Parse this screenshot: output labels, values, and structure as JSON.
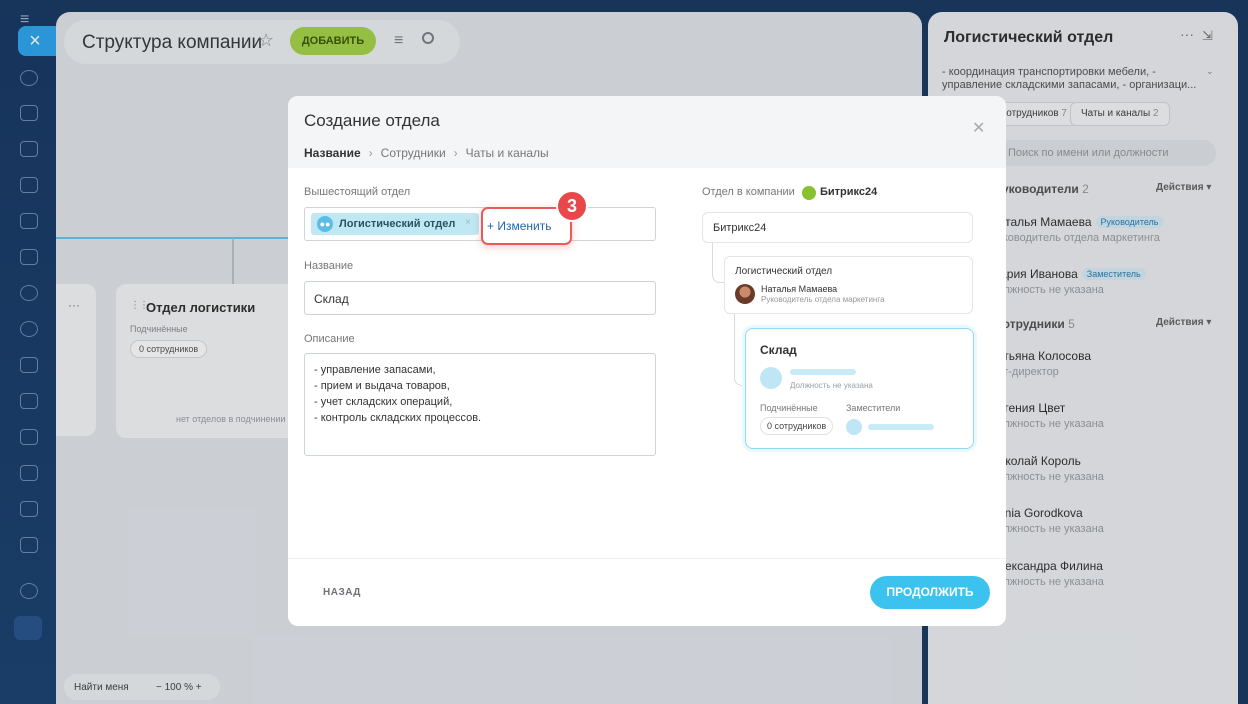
{
  "main": {
    "title": "Структура компании",
    "add_label": "ДОБАВИТЬ",
    "card_dept_name": "Отдел логистики",
    "card_sub_label": "Подчинённые",
    "card_sub_count": "0 сотрудников",
    "card_no_depts": "нет отделов в подчинении",
    "find_me": "Найти меня",
    "zoom": "− 100 % +"
  },
  "right": {
    "title": "Логистический отдел",
    "description": "- координация транспортировки мебели, - управление складскими запасами, - организаци...",
    "tab1_label": "Сотрудников",
    "tab1_count": "7",
    "tab2_label": "Чаты и каналы",
    "tab2_count": "2",
    "search_placeholder": "Поиск по имени или должности",
    "sections": [
      {
        "label": "Руководители",
        "count": "2",
        "action": "Действия"
      },
      {
        "label": "Сотрудники",
        "count": "5",
        "action": "Действия"
      }
    ],
    "employees": [
      {
        "name": "Наталья Мамаева",
        "badge": "Руководитель",
        "role": "Руководитель отдела маркетинга"
      },
      {
        "name": "Мария Иванова",
        "badge": "Заместитель",
        "role": "Должность не указана"
      },
      {
        "name": "Татьяна Колосова",
        "badge": "",
        "role": "Арт-директор"
      },
      {
        "name": "Евгения Цвет",
        "badge": "",
        "role": "Должность не указана"
      },
      {
        "name": "Николай Король",
        "badge": "",
        "role": "Должность не указана"
      },
      {
        "name": "Xenia Gorodkova",
        "badge": "",
        "role": "Должность не указана"
      },
      {
        "name": "Александра Филина",
        "badge": "",
        "role": "Должность не указана"
      }
    ]
  },
  "modal": {
    "title": "Создание отдела",
    "steps": [
      "Название",
      "Сотрудники",
      "Чаты и каналы"
    ],
    "parent_label": "Вышестоящий отдел",
    "parent_value": "Логистический отдел",
    "change_label": "+ Изменить",
    "step_number": "3",
    "name_label": "Название",
    "name_value": "Склад",
    "desc_label": "Описание",
    "desc_lines": [
      "- управление запасами,",
      "- прием и выдача товаров,",
      "- учет складских операций,",
      "- контроль складских процессов."
    ],
    "back_label": "НАЗАД",
    "continue_label": "ПРОДОЛЖИТЬ",
    "preview": {
      "label": "Отдел в компании",
      "company": "Битрикс24",
      "root": "Битрикс24",
      "parent_dept": "Логистический отдел",
      "head_name": "Наталья Мамаева",
      "head_role": "Руководитель отдела маркетинга",
      "new_dept": "Склад",
      "new_role": "Должность не указана",
      "sub_label": "Подчинённые",
      "deputies_label": "Заместители",
      "sub_count": "0 сотрудников"
    }
  },
  "colors": {
    "accent_blue": "#3bc2ee",
    "add_green": "#a6d54a",
    "highlight_red": "#e8484a"
  }
}
